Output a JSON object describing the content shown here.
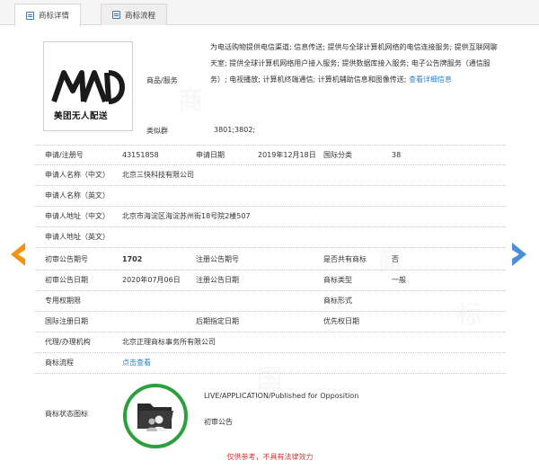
{
  "tabs": [
    {
      "label": "商标详情",
      "icon": "document-icon",
      "active": true
    },
    {
      "label": "商标流程",
      "icon": "document-icon",
      "active": false
    }
  ],
  "logo": {
    "text_cn": "美团无人配送"
  },
  "services": {
    "label": "商品/服务",
    "text": "为电话购物提供电信渠道; 信息传送; 提供与全球计算机网络的电信连接服务; 提供互联网聊天室; 提供全球计算机网络用户接入服务; 提供数据库接入服务; 电子公告牌服务（通信服务）; 电视播放; 计算机终端通信; 计算机辅助信息和图像传送;",
    "more_link": "查看详细信息"
  },
  "class_group": {
    "label": "类似群",
    "value": "3801;3802;"
  },
  "rows": {
    "reg_no_label": "申请/注册号",
    "reg_no": "43151858",
    "app_date_label": "申请日期",
    "app_date": "2019年12月18日",
    "intl_class_label": "国际分类",
    "intl_class": "38",
    "applicant_cn_label": "申请人名称（中文）",
    "applicant_cn": "北京三快科技有限公司",
    "applicant_en_label": "申请人名称（英文）",
    "address_cn_label": "申请人地址（中文）",
    "address_cn": "北京市海淀区海淀苏州街18号院2楼507",
    "address_en_label": "申请人地址（英文）",
    "prelim_pub_no_label": "初审公告期号",
    "prelim_pub_no": "1702",
    "reg_pub_no_label": "注册公告期号",
    "shared_label": "是否共有商标",
    "shared": "否",
    "prelim_pub_date_label": "初审公告日期",
    "prelim_pub_date": "2020年07月06日",
    "reg_pub_date_label": "注册公告日期",
    "mark_type_label": "商标类型",
    "mark_type": "一般",
    "exclusive_term_label": "专用权期限",
    "mark_form_label": "商标形式",
    "intl_reg_date_label": "国际注册日期",
    "later_designation_label": "后期指定日期",
    "priority_date_label": "优先权日期",
    "agent_label": "代理/办理机构",
    "agent": "北京正理商标事务所有限公司",
    "process_label": "商标流程",
    "process_link": "点击查看"
  },
  "status": {
    "label": "商标状态图标",
    "icon": "folder-users-icon",
    "text_en": "LIVE/APPLICATION/Published for Opposition",
    "text_cn": "初审公告"
  },
  "disclaimer": "仅供参考，不具有法律效力",
  "colors": {
    "accent": "#2f7fc8",
    "status_green": "#2ba03c",
    "left_arrow": "#f29312",
    "right_arrow": "#4a8fd8",
    "disclaimer": "#d33333"
  }
}
